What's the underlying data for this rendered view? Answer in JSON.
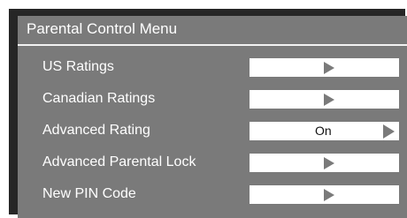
{
  "menu": {
    "title": "Parental Control Menu",
    "items": [
      {
        "label": "US Ratings",
        "value": "",
        "arrow": "play-arrow-icon"
      },
      {
        "label": "Canadian Ratings",
        "value": "",
        "arrow": "play-arrow-icon"
      },
      {
        "label": "Advanced Rating",
        "value": "On",
        "arrow": "play-arrow-icon"
      },
      {
        "label": "Advanced Parental Lock",
        "value": "",
        "arrow": "play-arrow-icon"
      },
      {
        "label": "New PIN Code",
        "value": "",
        "arrow": "play-arrow-icon"
      }
    ]
  }
}
